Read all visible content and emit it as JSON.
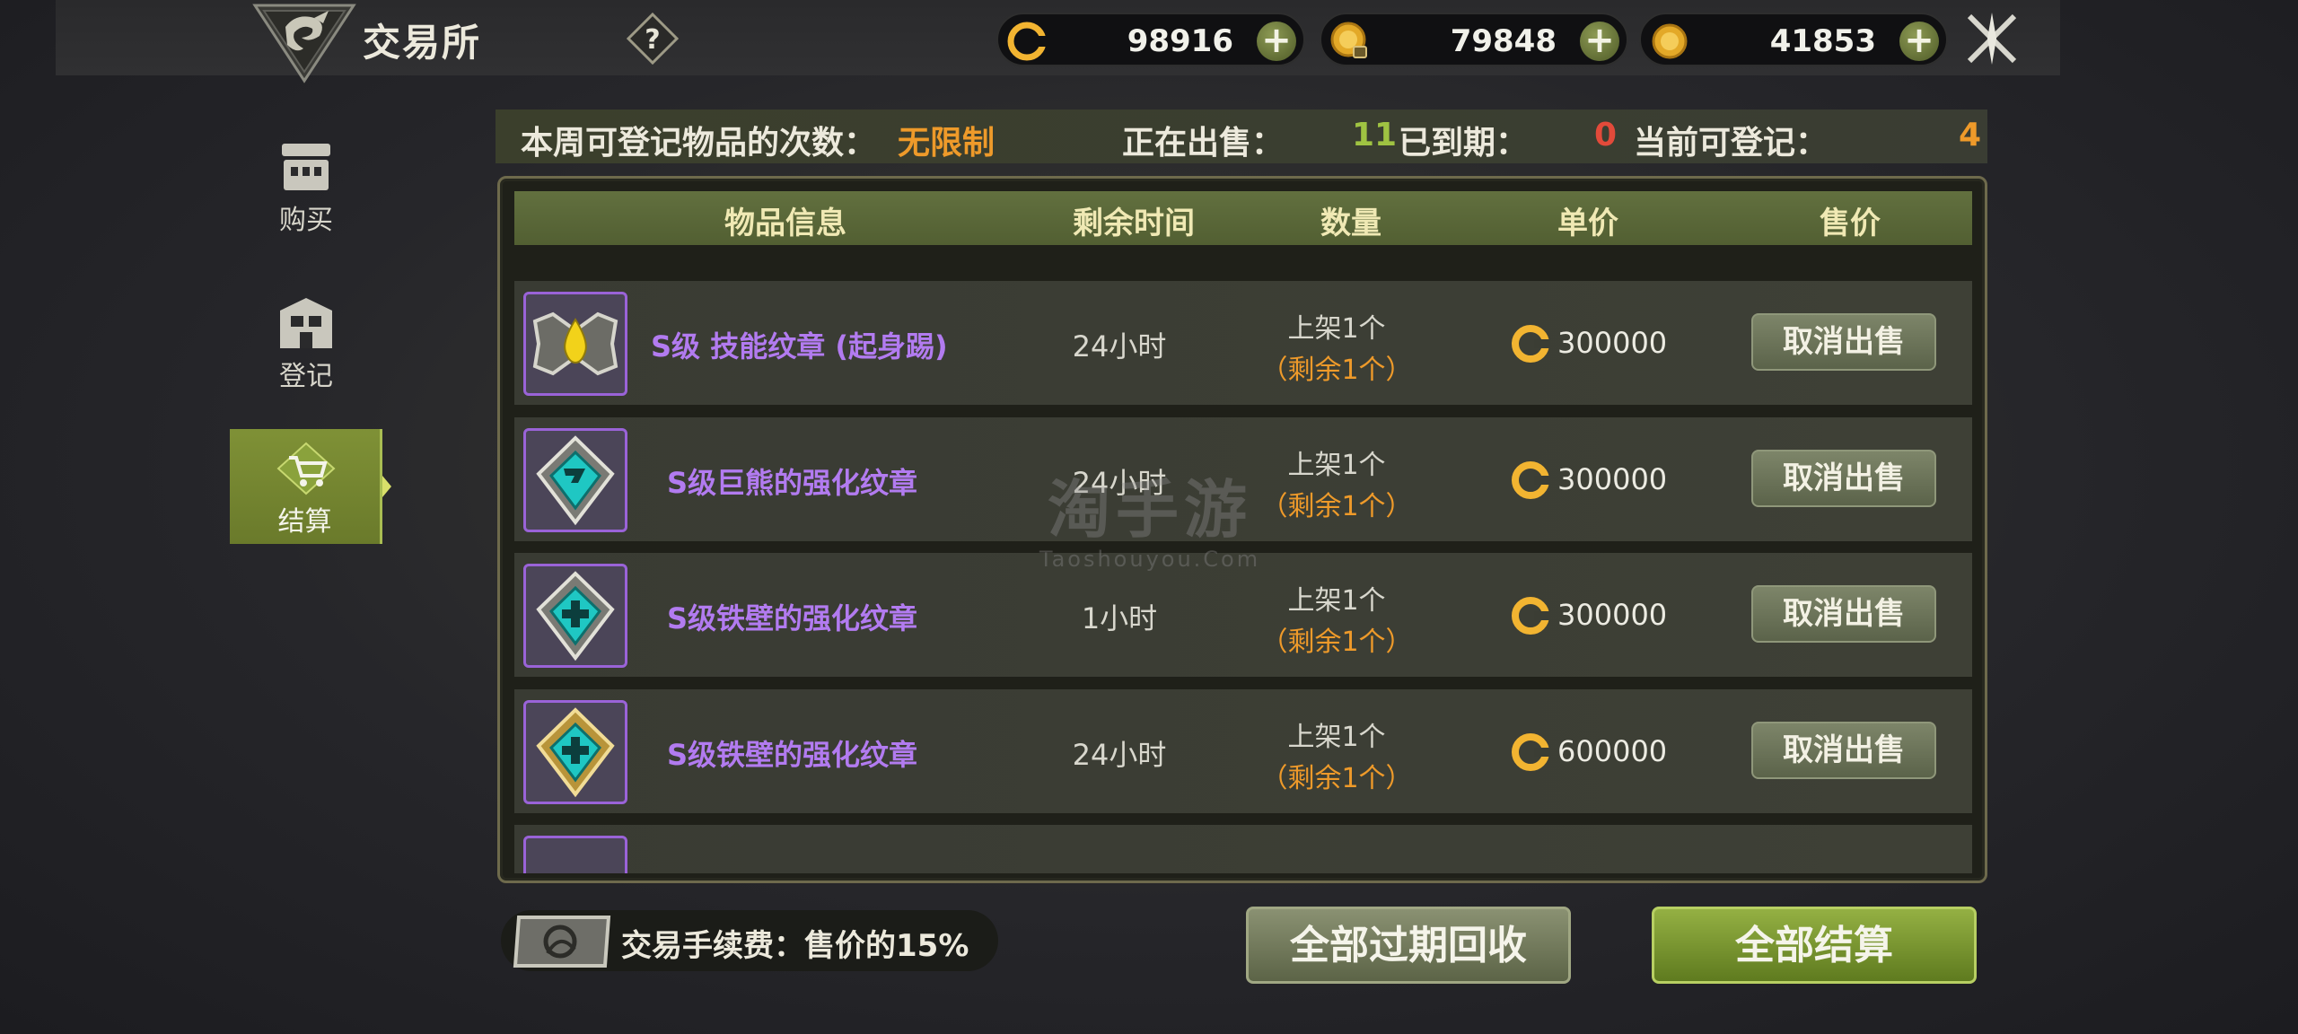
{
  "header": {
    "title": "交易所",
    "help_icon": "question-icon",
    "currencies": [
      {
        "name": "gold-coin-c",
        "value": "98916",
        "icon": "c-coin-icon"
      },
      {
        "name": "bonded-coin",
        "value": "79848",
        "icon": "bonded-coin-icon"
      },
      {
        "name": "gold-coin",
        "value": "41853",
        "icon": "gold-coin-icon"
      }
    ],
    "close_icon": "crossed-swords-close-icon"
  },
  "sidebar": {
    "items": [
      {
        "label": "购买",
        "icon": "shop-icon"
      },
      {
        "label": "登记",
        "icon": "register-icon"
      },
      {
        "label": "结算",
        "icon": "cart-icon",
        "active": true
      }
    ]
  },
  "summary": {
    "weekly_label": "本周可登记物品的次数：",
    "weekly_value": "无限制",
    "on_sale_label": "正在出售：",
    "on_sale_value": "11",
    "expired_label": "已到期：",
    "expired_value": "0",
    "registrable_label": "当前可登记：",
    "registrable_value": "4"
  },
  "table": {
    "headers": [
      "物品信息",
      "剩余时间",
      "数量",
      "单价",
      "售价"
    ],
    "rows": [
      {
        "name": "S级 技能纹章 (起身踢)",
        "time": "24小时",
        "qty": "上架1个",
        "remain": "（剩余1个）",
        "price": "300000",
        "action": "取消出售",
        "icon": "yellow-drop-emblem-icon"
      },
      {
        "name": "S级巨熊的强化纹章",
        "time": "24小时",
        "qty": "上架1个",
        "remain": "（剩余1个）",
        "price": "300000",
        "action": "取消出售",
        "icon": "bear-emblem-icon"
      },
      {
        "name": "S级铁壁的强化纹章",
        "time": "1小时",
        "qty": "上架1个",
        "remain": "（剩余1个）",
        "price": "300000",
        "action": "取消出售",
        "icon": "iron-wall-emblem-icon"
      },
      {
        "name": "S级铁壁的强化纹章",
        "time": "24小时",
        "qty": "上架1个",
        "remain": "（剩余1个）",
        "price": "600000",
        "action": "取消出售",
        "icon": "iron-wall-gold-emblem-icon"
      }
    ]
  },
  "watermark": {
    "main": "淘手游",
    "sub": "Taoshouyou.Com"
  },
  "footer": {
    "fee_label": "交易手续费：售价的15%",
    "recycle_label": "全部过期回收",
    "settle_label": "全部结算"
  },
  "colors": {
    "accent_green": "#7f9136",
    "orange": "#ee9a2a",
    "item_purple": "#b27bf0",
    "red": "#e24a3a"
  }
}
